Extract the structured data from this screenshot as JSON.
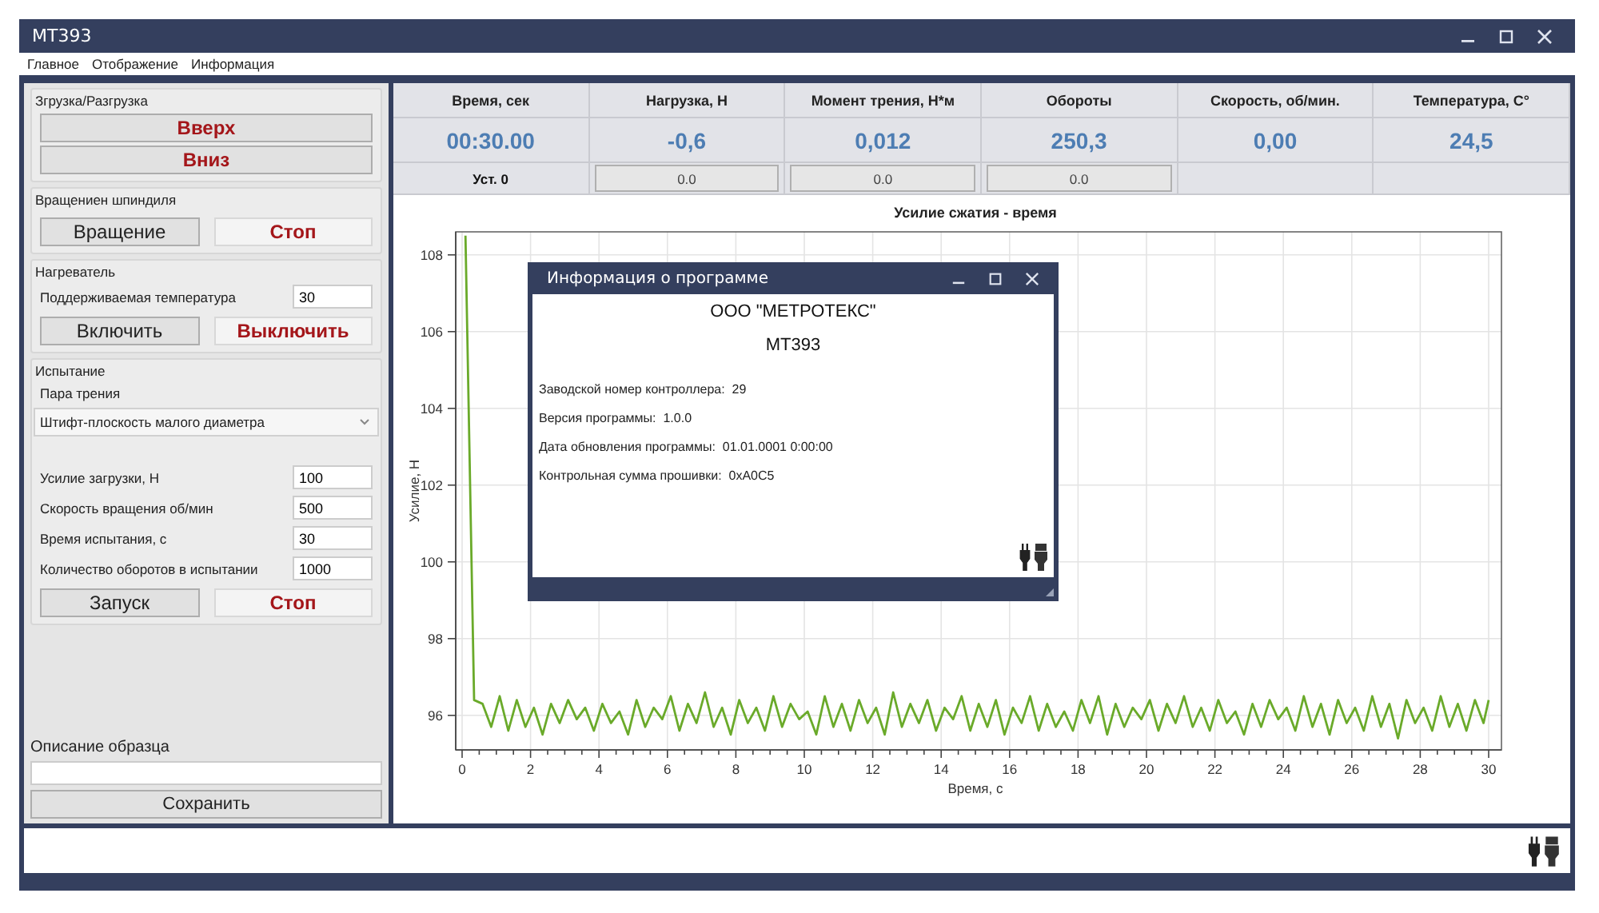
{
  "window": {
    "title": "MT393"
  },
  "menu": [
    {
      "label": "Главное"
    },
    {
      "label": "Отображение"
    },
    {
      "label": "Информация"
    }
  ],
  "load_group": {
    "title": "Згрузка/Разгрузка",
    "buttons": [
      {
        "label": "Вверх",
        "kind": "stop"
      },
      {
        "label": "Вниз",
        "kind": "stop"
      }
    ]
  },
  "spindle_group": {
    "title": "Вращениен шпиндиля",
    "buttons": [
      {
        "label": "Вращение",
        "kind": "normal"
      },
      {
        "label": "Стоп",
        "kind": "stop"
      }
    ]
  },
  "heater_group": {
    "title": "Нагреватель",
    "field": {
      "label": "Поддерживаемая температура",
      "value": "30"
    },
    "buttons": [
      {
        "label": "Включить",
        "kind": "normal"
      },
      {
        "label": "Выключить",
        "kind": "stop"
      }
    ]
  },
  "test_group": {
    "title": "Испытание",
    "pair_label": "Пара трения",
    "pair_value": "Штифт-плоскость малого диаметра",
    "fields": [
      {
        "label": "Усилие загрузки, Н",
        "value": "100"
      },
      {
        "label": "Скорость вращения об/мин",
        "value": "500"
      },
      {
        "label": "Время испытания, с",
        "value": "30"
      },
      {
        "label": "Количество оборотов в испытании",
        "value": "1000"
      }
    ],
    "buttons": [
      {
        "label": "Запуск",
        "kind": "normal"
      },
      {
        "label": "Стоп",
        "kind": "stop"
      }
    ]
  },
  "sample": {
    "label": "Описание образца",
    "save": "Сохранить"
  },
  "readings": [
    {
      "header": "Время, сек",
      "value": "00:30.00",
      "setting": {
        "kind": "label",
        "text": "Уст. 0"
      }
    },
    {
      "header": "Нагрузка, Н",
      "value": "-0,6",
      "setting": {
        "kind": "field",
        "text": "0.0"
      }
    },
    {
      "header": "Момент трения, Н*м",
      "value": "0,012",
      "setting": {
        "kind": "field",
        "text": "0.0"
      }
    },
    {
      "header": "Обороты",
      "value": "250,3",
      "setting": {
        "kind": "field",
        "text": "0.0"
      }
    },
    {
      "header": "Скорость, об/мин.",
      "value": "0,00",
      "setting": {
        "kind": "empty"
      }
    },
    {
      "header": "Температура, C°",
      "value": "24,5",
      "setting": {
        "kind": "empty"
      }
    }
  ],
  "chart_data": {
    "type": "line",
    "title": "Усилие сжатия - время",
    "xlabel": "Время, с",
    "ylabel": "Усилие, Н",
    "xlim": [
      0,
      30
    ],
    "ylim": [
      95.1,
      108.6
    ],
    "xticks": [
      0,
      2,
      4,
      6,
      8,
      10,
      12,
      14,
      16,
      18,
      20,
      22,
      24,
      26,
      28,
      30
    ],
    "yticks": [
      96,
      98,
      100,
      102,
      104,
      106,
      108
    ],
    "x": [
      0.1,
      0.35,
      0.6,
      0.85,
      1.1,
      1.35,
      1.6,
      1.85,
      2.1,
      2.35,
      2.6,
      2.85,
      3.1,
      3.35,
      3.6,
      3.85,
      4.1,
      4.35,
      4.6,
      4.85,
      5.1,
      5.35,
      5.6,
      5.85,
      6.1,
      6.35,
      6.6,
      6.85,
      7.1,
      7.35,
      7.6,
      7.85,
      8.1,
      8.35,
      8.6,
      8.85,
      9.1,
      9.35,
      9.6,
      9.85,
      10.1,
      10.35,
      10.6,
      10.85,
      11.1,
      11.35,
      11.6,
      11.85,
      12.1,
      12.35,
      12.6,
      12.85,
      13.1,
      13.35,
      13.6,
      13.85,
      14.1,
      14.35,
      14.6,
      14.85,
      15.1,
      15.35,
      15.6,
      15.85,
      16.1,
      16.35,
      16.6,
      16.85,
      17.1,
      17.35,
      17.6,
      17.85,
      18.1,
      18.35,
      18.6,
      18.85,
      19.1,
      19.35,
      19.6,
      19.85,
      20.1,
      20.35,
      20.6,
      20.85,
      21.1,
      21.35,
      21.6,
      21.85,
      22.1,
      22.35,
      22.6,
      22.85,
      23.1,
      23.35,
      23.6,
      23.85,
      24.1,
      24.35,
      24.6,
      24.85,
      25.1,
      25.35,
      25.6,
      25.85,
      26.1,
      26.35,
      26.6,
      26.85,
      27.1,
      27.35,
      27.6,
      27.85,
      28.1,
      28.35,
      28.6,
      28.85,
      29.1,
      29.35,
      29.6,
      29.85,
      30.0
    ],
    "grid": true,
    "series": [
      {
        "color": "#6aaa2a",
        "values": [
          108.5,
          96.4,
          96.3,
          95.7,
          96.5,
          95.6,
          96.4,
          95.7,
          96.2,
          95.5,
          96.3,
          95.8,
          96.4,
          95.9,
          96.2,
          95.6,
          96.3,
          95.8,
          96.1,
          95.5,
          96.4,
          95.7,
          96.2,
          95.9,
          96.5,
          95.6,
          96.3,
          95.8,
          96.6,
          95.7,
          96.2,
          95.5,
          96.4,
          95.8,
          96.2,
          95.6,
          96.5,
          95.7,
          96.3,
          95.9,
          96.1,
          95.5,
          96.5,
          95.7,
          96.3,
          95.6,
          96.4,
          95.8,
          96.2,
          95.5,
          96.6,
          95.7,
          96.3,
          95.8,
          96.4,
          95.6,
          96.2,
          95.9,
          96.5,
          95.6,
          96.3,
          95.7,
          96.4,
          95.5,
          96.2,
          95.8,
          96.5,
          95.6,
          96.3,
          95.7,
          96.1,
          95.6,
          96.4,
          95.8,
          96.5,
          95.5,
          96.3,
          95.7,
          96.2,
          95.9,
          96.4,
          95.6,
          96.3,
          95.8,
          96.5,
          95.7,
          96.2,
          95.6,
          96.4,
          95.8,
          96.1,
          95.5,
          96.3,
          95.7,
          96.4,
          95.9,
          96.2,
          95.6,
          96.5,
          95.7,
          96.3,
          95.5,
          96.4,
          95.8,
          96.2,
          95.6,
          96.5,
          95.7,
          96.3,
          95.4,
          96.4,
          95.8,
          96.2,
          95.6,
          96.5,
          95.7,
          96.3,
          95.6,
          96.4,
          95.8,
          96.4
        ]
      }
    ]
  },
  "dialog": {
    "title": "Информация о программе",
    "company": "ООО \"МЕТРОТЕКС\"",
    "model": "MT393",
    "lines": [
      {
        "label": "Заводской номер контроллера:",
        "value": "29"
      },
      {
        "label": "Версия программы:",
        "value": "1.0.0"
      },
      {
        "label": "Дата обновления программы:",
        "value": "01.01.0001 0:00:00"
      },
      {
        "label": "Контрольная сумма прошивки:",
        "value": "0xA0C5"
      }
    ]
  }
}
